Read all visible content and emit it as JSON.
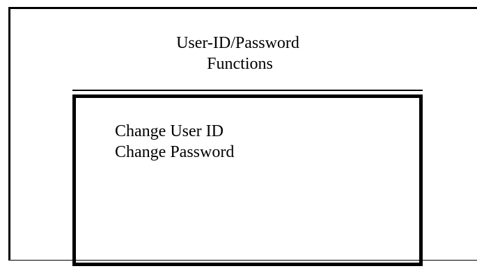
{
  "window": {
    "title_line_1": "User-ID/Password",
    "title_line_2": "Functions"
  },
  "menu": {
    "items": [
      {
        "label": "Change User ID"
      },
      {
        "label": "Change Password"
      }
    ]
  }
}
